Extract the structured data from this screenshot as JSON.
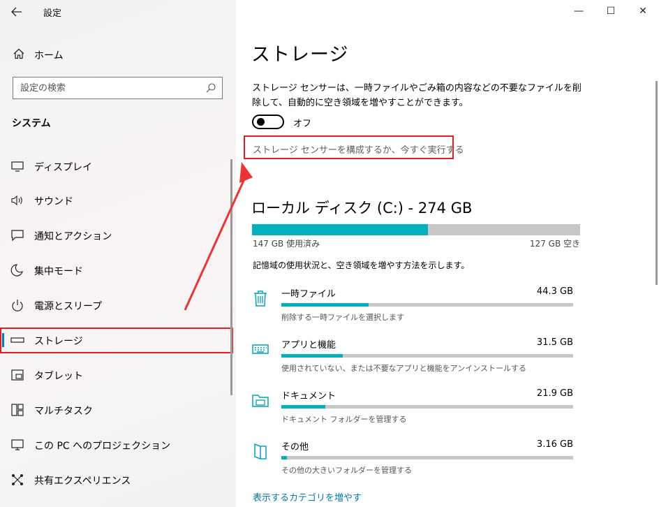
{
  "window": {
    "title": "設定",
    "controls": {
      "minimize": "—",
      "maximize": "☐",
      "close": "✕"
    }
  },
  "sidebar": {
    "home_label": "ホーム",
    "search_placeholder": "設定の検索",
    "section_header": "システム",
    "items": [
      {
        "label": "ディスプレイ",
        "icon": "monitor-icon"
      },
      {
        "label": "サウンド",
        "icon": "speaker-icon"
      },
      {
        "label": "通知とアクション",
        "icon": "notification-icon"
      },
      {
        "label": "集中モード",
        "icon": "moon-icon"
      },
      {
        "label": "電源とスリープ",
        "icon": "power-icon"
      },
      {
        "label": "ストレージ",
        "icon": "storage-icon",
        "active": true
      },
      {
        "label": "タブレット",
        "icon": "tablet-icon"
      },
      {
        "label": "マルチタスク",
        "icon": "multitask-icon"
      },
      {
        "label": "この PC へのプロジェクション",
        "icon": "projection-icon"
      },
      {
        "label": "共有エクスペリエンス",
        "icon": "share-icon"
      }
    ]
  },
  "main": {
    "title": "ストレージ",
    "description": "ストレージ センサーは、一時ファイルやごみ箱の内容などの不要なファイルを削除して、自動的に空き領域を増やすことができます。",
    "toggle_state": "オフ",
    "configure_link": "ストレージ センサーを構成するか、今すぐ実行する",
    "disk": {
      "title": "ローカル ディスク (C:) - 274 GB",
      "used_label": "147 GB 使用済み",
      "free_label": "127 GB 空き",
      "used_fraction": 0.536
    },
    "info": "記憶域の使用状況と、空き領域を増やす方法を示します。",
    "categories": [
      {
        "name": "一時ファイル",
        "size": "44.3 GB",
        "sub": "削除する一時ファイルを選択します",
        "icon": "trash-icon",
        "fraction": 0.3
      },
      {
        "name": "アプリと機能",
        "size": "31.5 GB",
        "sub": "使用されていない、または不要なアプリと機能をアンインストールする",
        "icon": "keyboard-icon",
        "fraction": 0.21
      },
      {
        "name": "ドキュメント",
        "size": "21.9 GB",
        "sub": "ドキュメント フォルダーを管理する",
        "icon": "folder-icon",
        "fraction": 0.15
      },
      {
        "name": "その他",
        "size": "3.16 GB",
        "sub": "その他の大きいフォルダーを管理する",
        "icon": "document-icon",
        "fraction": 0.02
      }
    ],
    "more_link": "表示するカテゴリを増やす"
  },
  "colors": {
    "accent": "#0078d7",
    "bar_fill": "#00b2bf",
    "bar_track": "#c8c8c8",
    "annotation_red": "#e02020",
    "link": "#0078b4"
  }
}
